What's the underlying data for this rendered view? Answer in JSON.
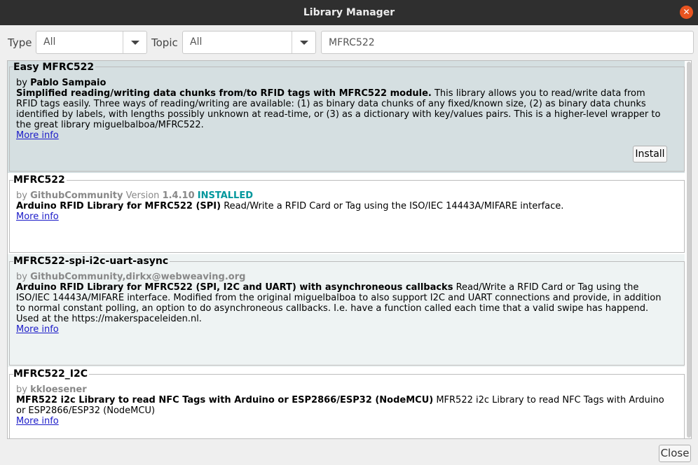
{
  "window": {
    "title": "Library Manager",
    "close_symbol": "✕"
  },
  "filters": {
    "type_label": "Type",
    "type_value": "All",
    "topic_label": "Topic",
    "topic_value": "All",
    "search_value": "MFRC522"
  },
  "libraries": [
    {
      "name": "Easy MFRC522",
      "by_label": "by",
      "author": "Pablo Sampaio",
      "summary": "Simplified reading/writing data chunks from/to RFID tags with MFRC522 module.",
      "description": " This library allows you to read/write data from RFID tags easily. Three ways of reading/writing are available: (1) as binary data chunks of any fixed/known size, (2) as binary data chunks identified by labels, with lengths possibly unknown at read-time, or (3) as a dictionary with key/values pairs. This is a higher-level wrapper to the great library miguelbalboa/MFRC522.",
      "more_info": "More info",
      "install_label": "Install"
    },
    {
      "name": "MFRC522",
      "by_label": "by",
      "author": "GithubCommunity",
      "version_label": "Version",
      "version": "1.4.10",
      "status": "INSTALLED",
      "summary": "Arduino RFID Library for MFRC522 (SPI)",
      "description": " Read/Write a RFID Card or Tag using the ISO/IEC 14443A/MIFARE interface.",
      "more_info": "More info"
    },
    {
      "name": "MFRC522-spi-i2c-uart-async",
      "by_label": "by",
      "author": "GithubCommunity,dirkx@webweaving.org",
      "summary": "Arduino RFID Library for MFRC522 (SPI, I2C and UART) with asynchroneous callbacks",
      "description": " Read/Write a RFID Card or Tag using the ISO/IEC 14443A/MIFARE interface. Modified from the original miguelbalboa to also support I2C and UART connections and provide, in addition to normal constant polling, an option to do asynchroneous callbacks. I.e. have a function called each time that a valid swipe has happend. Used at the https://makerspaceleiden.nl.",
      "more_info": "More info"
    },
    {
      "name": "MFRC522_I2C",
      "by_label": "by",
      "author": "kkloesener",
      "summary": "MFR522 i2c Library to read NFC Tags with Arduino or ESP2866/ESP32 (NodeMCU)",
      "description": " MFR522 i2c Library to read NFC Tags with Arduino or ESP2866/ESP32 (NodeMCU)",
      "more_info": "More info"
    }
  ],
  "footer": {
    "close_label": "Close"
  },
  "colors": {
    "titlebar": "#2f2f2f",
    "close_accent": "#e95420",
    "selected_row": "#d5dfe1",
    "alt_row": "#eef3f3",
    "installed": "#00979c",
    "link": "#1a1ac8"
  }
}
